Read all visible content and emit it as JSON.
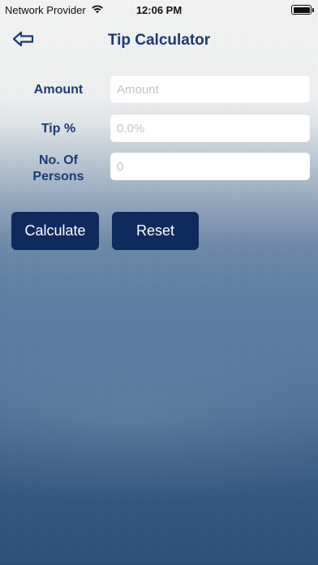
{
  "status_bar": {
    "carrier": "Network Provider",
    "time": "12:06 PM",
    "icons": [
      "wifi-icon",
      "battery-icon"
    ]
  },
  "nav": {
    "title": "Tip Calculator",
    "back_icon": "back-arrow-icon"
  },
  "form": {
    "amount": {
      "label": "Amount",
      "value": "",
      "placeholder": "Amount"
    },
    "tip": {
      "label": "Tip %",
      "value": "",
      "placeholder": "0.0%"
    },
    "persons": {
      "label_line1": "No. Of",
      "label_line2": "Persons",
      "value": "",
      "placeholder": "0"
    }
  },
  "buttons": {
    "calculate": "Calculate",
    "reset": "Reset"
  },
  "colors": {
    "accent": "#1c3b74",
    "button_bg": "#0f2b5e"
  }
}
